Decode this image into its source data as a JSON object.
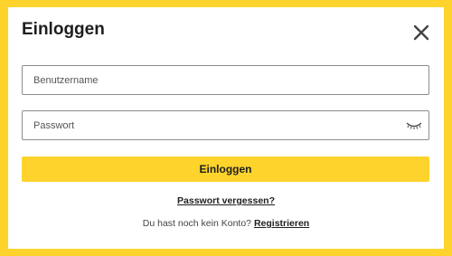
{
  "dialog": {
    "title": "Einloggen",
    "close_icon": "close-icon"
  },
  "form": {
    "username_placeholder": "Benutzername",
    "username_value": "",
    "password_placeholder": "Passwort",
    "password_value": "",
    "password_toggle_icon": "eye-closed-icon",
    "submit_label": "Einloggen"
  },
  "links": {
    "forgot_password": "Passwort vergessen?",
    "no_account_text": "Du hast noch kein Konto?",
    "register": "Registrieren"
  },
  "colors": {
    "accent": "#fdd32c",
    "text": "#1e1e1e"
  }
}
